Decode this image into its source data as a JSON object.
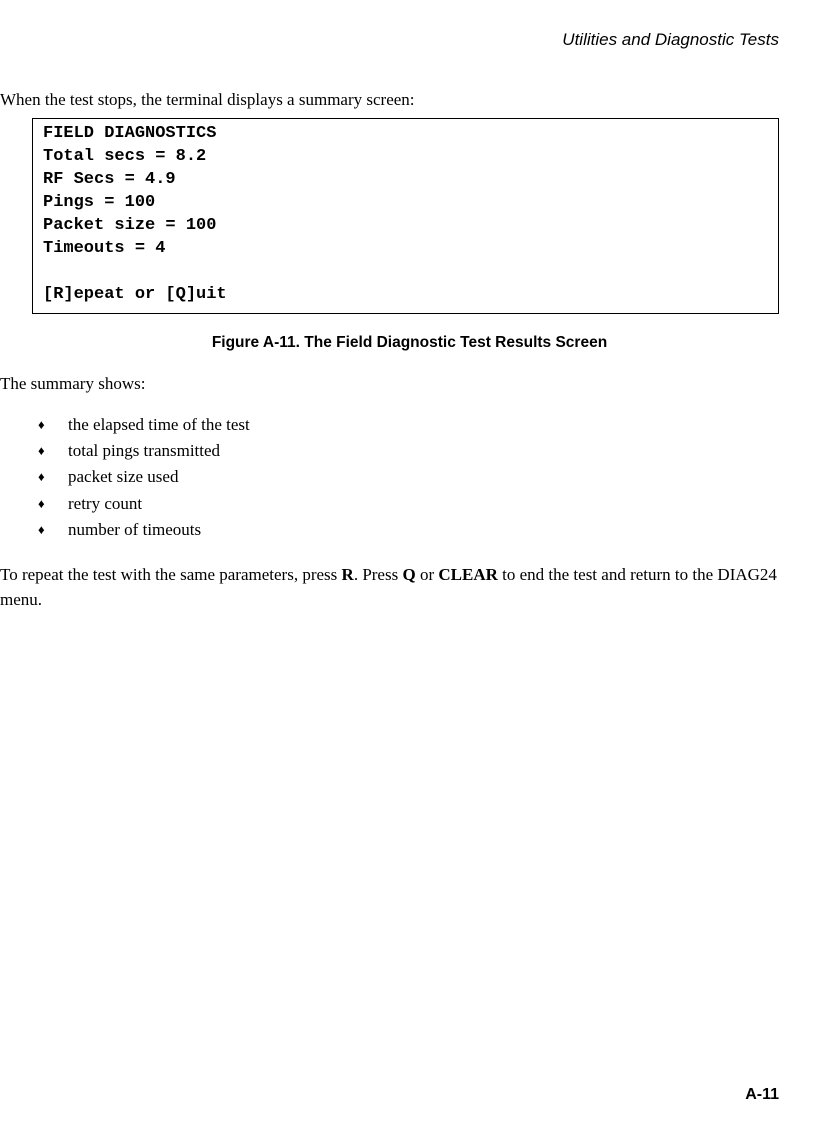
{
  "header": {
    "title": "Utilities and Diagnostic Tests"
  },
  "intro": "When the test stops, the terminal displays a summary screen:",
  "code_box": {
    "line1": "FIELD DIAGNOSTICS",
    "line2": "Total secs = 8.2",
    "line3": "RF Secs = 4.9",
    "line4": "Pings = 100",
    "line5": "Packet size = 100",
    "line6": "Timeouts = 4",
    "line7": "",
    "line8": "[R]epeat or [Q]uit"
  },
  "figure_caption": "Figure A-11.  The Field Diagnostic Test Results Screen",
  "summary_intro": "The summary shows:",
  "bullets": {
    "b1": "the elapsed time of the test",
    "b2": "total pings transmitted",
    "b3": "packet size used",
    "b4": "retry count",
    "b5": "number of timeouts"
  },
  "closing": {
    "prefix": "To repeat the test with the same parameters, press ",
    "key_r": "R",
    "mid1": ". Press ",
    "key_q": "Q",
    "mid2": " or ",
    "key_clear": "CLEAR",
    "suffix": " to end the test and return to the DIAG24 menu."
  },
  "page_number": "A-11"
}
